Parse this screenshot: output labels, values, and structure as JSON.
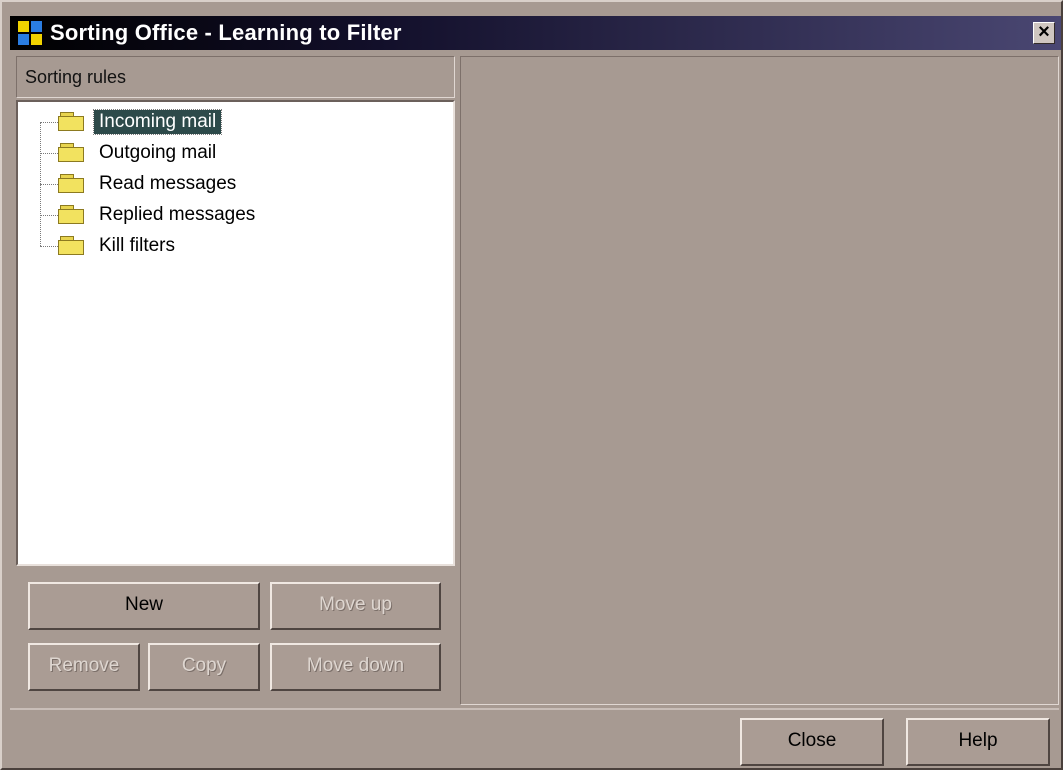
{
  "window": {
    "title": "Sorting Office - Learning to Filter",
    "close_glyph": "×",
    "icon": "sorting-office-icon"
  },
  "left": {
    "header": "Sorting rules",
    "tree": [
      {
        "label": "Incoming mail",
        "selected": true
      },
      {
        "label": "Outgoing mail",
        "selected": false
      },
      {
        "label": "Read messages",
        "selected": false
      },
      {
        "label": "Replied messages",
        "selected": false
      },
      {
        "label": "Kill filters",
        "selected": false
      }
    ]
  },
  "buttons": {
    "new": "New",
    "move_up": "Move up",
    "remove": "Remove",
    "copy": "Copy",
    "move_down": "Move down",
    "close": "Close",
    "help": "Help"
  }
}
